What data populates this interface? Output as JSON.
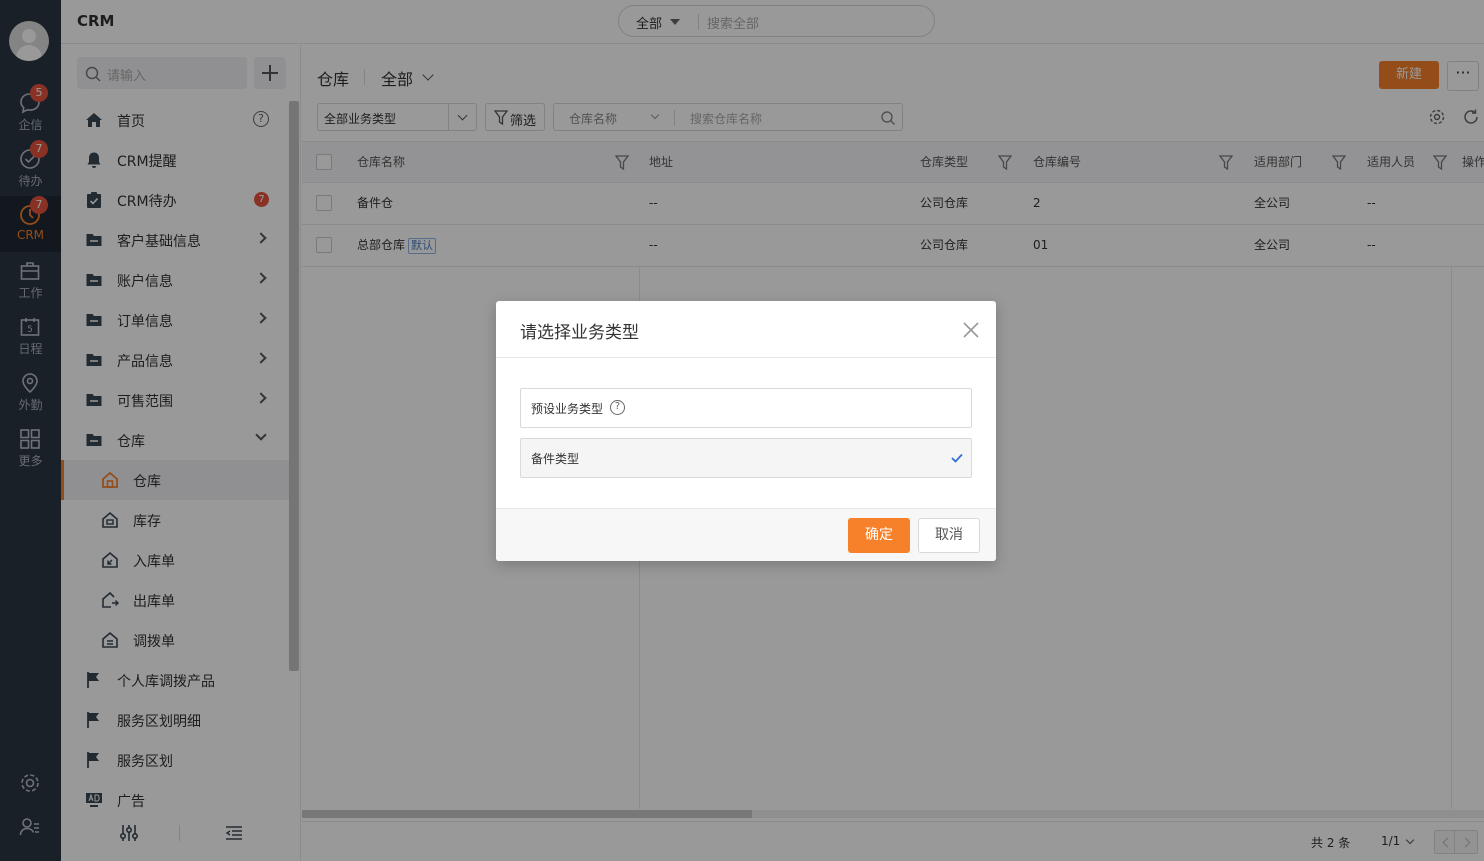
{
  "rail": {
    "items": [
      {
        "label": "企信",
        "badge": "5"
      },
      {
        "label": "待办",
        "badge": "7"
      },
      {
        "label": "CRM",
        "badge": "7"
      },
      {
        "label": "工作"
      },
      {
        "label": "日程",
        "icon_text": "5"
      },
      {
        "label": "外勤"
      },
      {
        "label": "更多"
      }
    ]
  },
  "topbar": {
    "app_title": "CRM",
    "search_scope": "全部",
    "search_placeholder": "搜索全部"
  },
  "sidebar": {
    "search_placeholder": "请输入",
    "items": [
      {
        "label": "首页"
      },
      {
        "label": "CRM提醒"
      },
      {
        "label": "CRM待办",
        "count": "7"
      },
      {
        "label": "客户基础信息"
      },
      {
        "label": "账户信息"
      },
      {
        "label": "订单信息"
      },
      {
        "label": "产品信息"
      },
      {
        "label": "可售范围"
      },
      {
        "label": "仓库"
      }
    ],
    "sub_items": [
      {
        "label": "仓库"
      },
      {
        "label": "库存"
      },
      {
        "label": "入库单"
      },
      {
        "label": "出库单"
      },
      {
        "label": "调拨单"
      }
    ],
    "more_items": [
      {
        "label": "个人库调拨产品"
      },
      {
        "label": "服务区划明细"
      },
      {
        "label": "服务区划"
      },
      {
        "label": "广告"
      }
    ]
  },
  "main": {
    "breadcrumb_title": "仓库",
    "view_selector": "全部",
    "new_button": "新建",
    "more_button": "···",
    "type_filter": "全部业务类型",
    "filter_button": "筛选",
    "search_field": "仓库名称",
    "search_placeholder": "搜索仓库名称",
    "columns": [
      "仓库名称",
      "地址",
      "仓库类型",
      "仓库编号",
      "适用部门",
      "适用人员",
      "操作"
    ],
    "rows": [
      {
        "name": "备件仓",
        "address": "--",
        "type": "公司仓库",
        "code": "2",
        "dept": "全公司",
        "staff": "--",
        "tag": ""
      },
      {
        "name": "总部仓库",
        "address": "--",
        "type": "公司仓库",
        "code": "01",
        "dept": "全公司",
        "staff": "--",
        "tag": "默认"
      }
    ],
    "total_text": "共 2 条",
    "page_text": "1/1"
  },
  "modal": {
    "title": "请选择业务类型",
    "options": [
      {
        "label": "预设业务类型"
      },
      {
        "label": "备件类型"
      }
    ],
    "ok": "确定",
    "cancel": "取消"
  },
  "colors": {
    "accent": "#f7812a",
    "rail_bg": "#2b3643",
    "badge": "#e7533f",
    "check": "#2f6fd6"
  }
}
